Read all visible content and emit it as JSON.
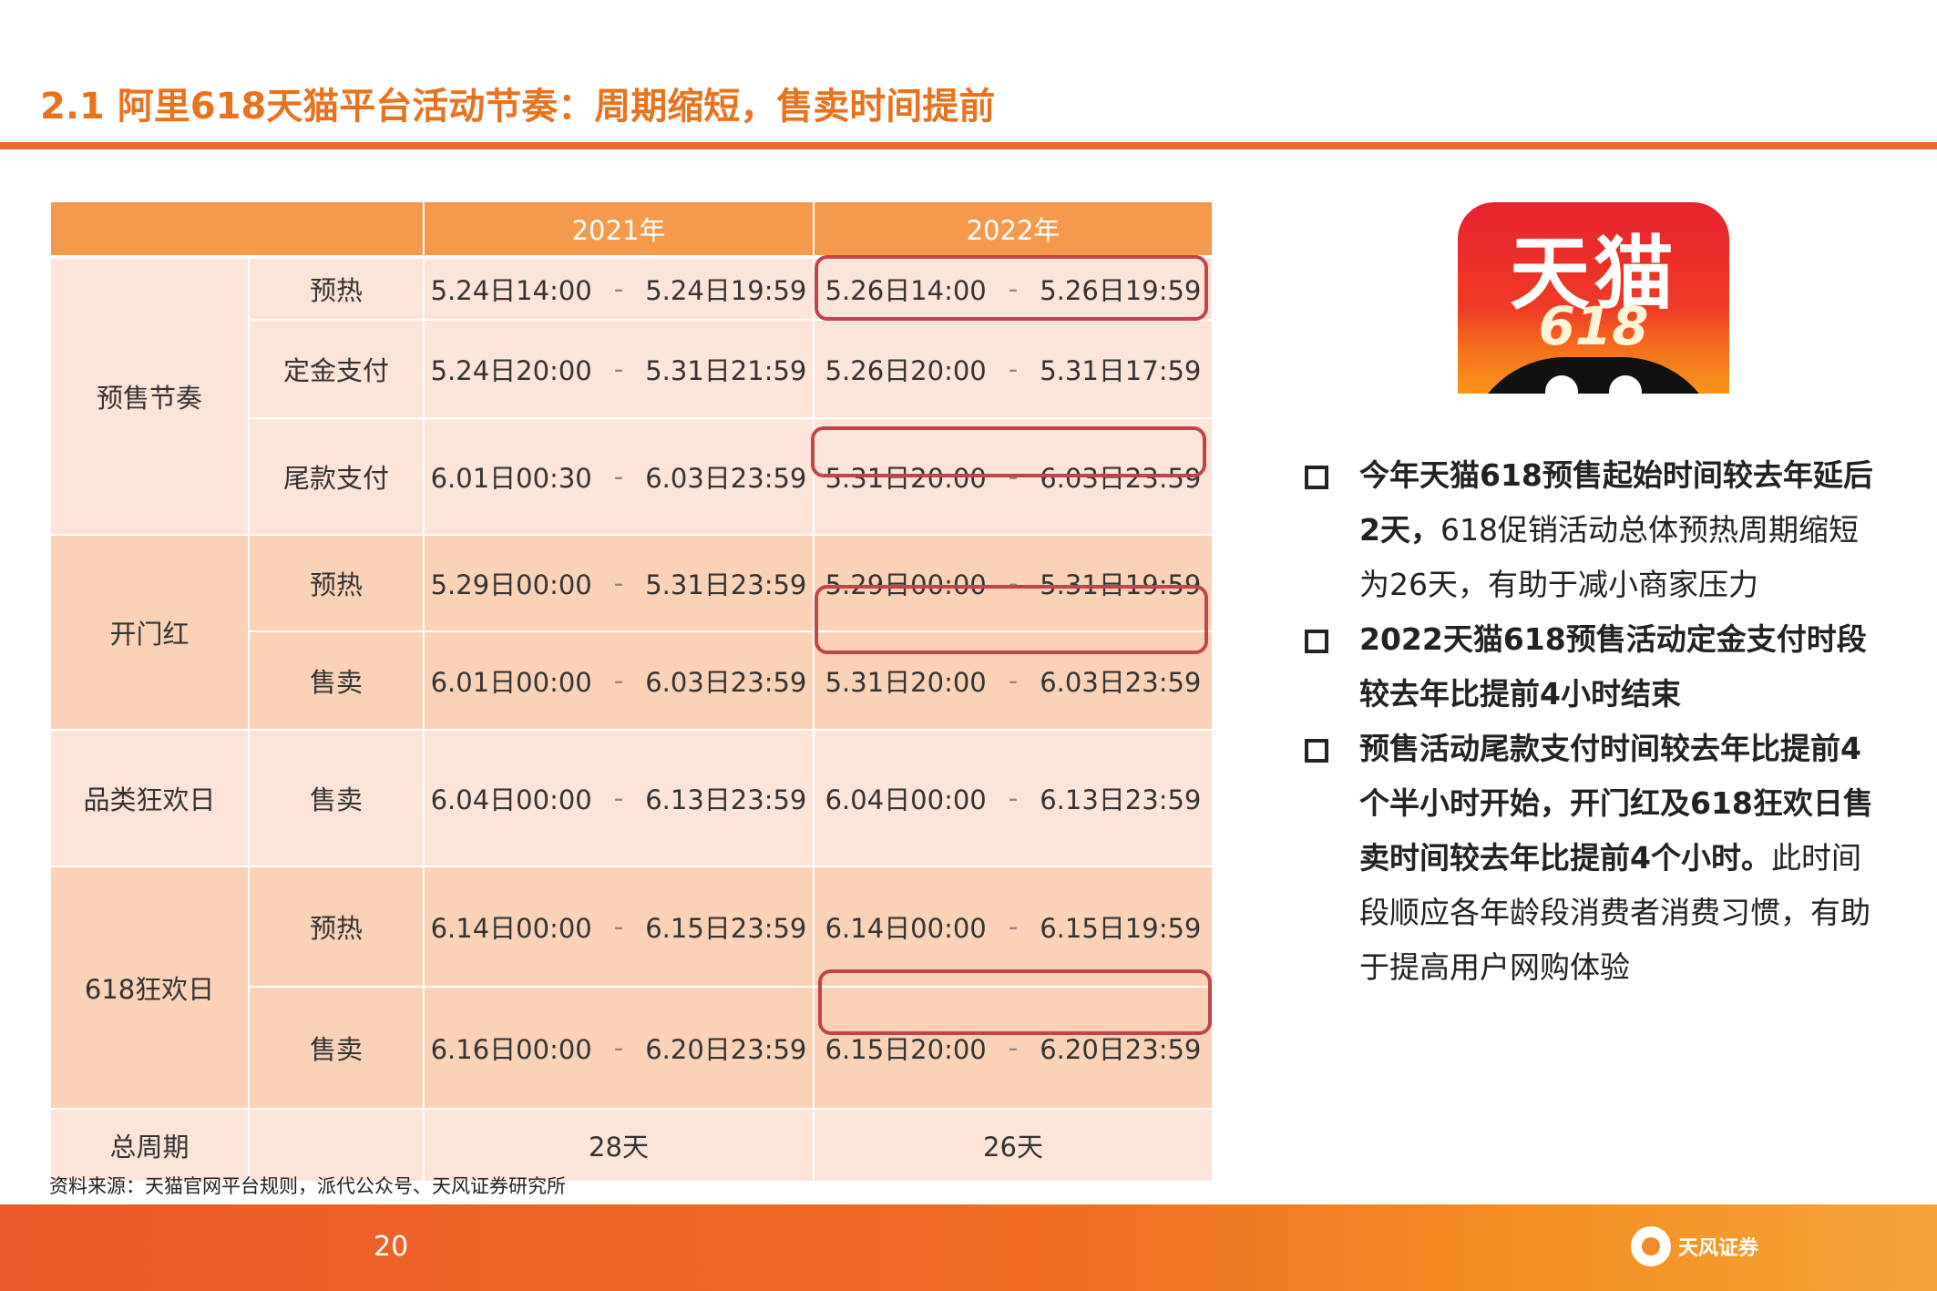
{
  "title": "2.1 阿里618天猫平台活动节奏：周期缩短，售卖时间提前",
  "table": {
    "headers": [
      "2021年",
      "2022年"
    ],
    "groups": {
      "presale": "预售节奏",
      "kaimen": "开门红",
      "category": "品类狂欢日",
      "carnival": "618狂欢日",
      "total": "总周期"
    },
    "rows": [
      {
        "stage": "预热",
        "y2021_start": "5.24日14:00",
        "y2021_end": "5.24日19:59",
        "y2022_start": "5.26日14:00",
        "y2022_end": "5.26日19:59",
        "highlight": true
      },
      {
        "stage": "定金支付",
        "y2021_start": "5.24日20:00",
        "y2021_end": "5.31日21:59",
        "y2022_start": "5.26日20:00",
        "y2022_end": "5.31日17:59",
        "highlight": false
      },
      {
        "stage": "尾款支付",
        "y2021_start": "6.01日00:30",
        "y2021_end": "6.03日23:59",
        "y2022_start": "5.31日20:00",
        "y2022_end": "6.03日23:59",
        "highlight": true
      },
      {
        "stage": "预热",
        "y2021_start": "5.29日00:00",
        "y2021_end": "5.31日23:59",
        "y2022_start": "5.29日00:00",
        "y2022_end": "5.31日19:59",
        "highlight": false
      },
      {
        "stage": "售卖",
        "y2021_start": "6.01日00:00",
        "y2021_end": "6.03日23:59",
        "y2022_start": "5.31日20:00",
        "y2022_end": "6.03日23:59",
        "highlight": true
      },
      {
        "stage": "售卖",
        "y2021_start": "6.04日00:00",
        "y2021_end": "6.13日23:59",
        "y2022_start": "6.04日00:00",
        "y2022_end": "6.13日23:59",
        "highlight": false
      },
      {
        "stage": "预热",
        "y2021_start": "6.14日00:00",
        "y2021_end": "6.15日23:59",
        "y2022_start": "6.14日00:00",
        "y2022_end": "6.15日19:59",
        "highlight": false
      },
      {
        "stage": "售卖",
        "y2021_start": "6.16日00:00",
        "y2021_end": "6.20日23:59",
        "y2022_start": "6.15日20:00",
        "y2022_end": "6.20日23:59",
        "highlight": true
      }
    ],
    "dash": "-",
    "total_2021": "28天",
    "total_2022": "26天"
  },
  "logo": {
    "text": "天猫",
    "number": "618"
  },
  "bullets": [
    {
      "bold": "今年天猫618预售起始时间较去年延后2天，",
      "normal": "618促销活动总体预热周期缩短为26天，有助于减小商家压力"
    },
    {
      "bold": "2022天猫618预售活动定金支付时段较去年比提前4小时结束",
      "normal": ""
    },
    {
      "bold": "预售活动尾款支付时间较去年比提前4个半小时开始，开门红及618狂欢日售卖时间较去年比提前4个小时。",
      "normal": "此时间段顺应各年龄段消费者消费习惯，有助于提高用户网购体验"
    }
  ],
  "source": "资料来源：天猫官网平台规则，派代公众号、天风证券研究所",
  "footer": {
    "page": "20",
    "brand": "天风证券"
  },
  "colors": {
    "accent": "#e8731f",
    "header": "#f59a4c",
    "light": "#fde4d8",
    "mid": "#fbd2b6",
    "highlight_border": "#c0444b"
  }
}
